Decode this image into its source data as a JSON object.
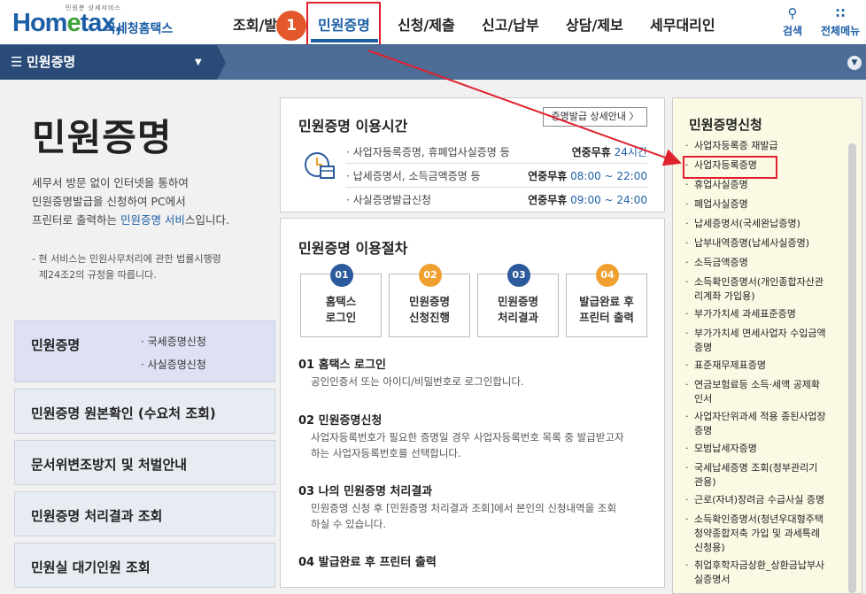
{
  "header": {
    "logo_tagline": "민원분 상세서비스",
    "logo_word_a": "Hom",
    "logo_word_e": "e",
    "logo_word_b": "tax,",
    "logo_kor": "국세청홈택스",
    "nav": [
      "조회/발",
      "민원증명",
      "신청/제출",
      "신고/납부",
      "상담/제보",
      "세무대리인"
    ],
    "search_label": "검색",
    "allmenu_label": "전체메뉴"
  },
  "step_badge": "1",
  "subnav": {
    "current": "민원증명"
  },
  "left": {
    "title": "민원증명",
    "intro_1": "세무서 방문 없이 인터넷을 통하여",
    "intro_2": "민원증명발급을 신청하여 PC에서",
    "intro_3a": "프린터로 출력하는 ",
    "intro_3b": "민원증명 서비",
    "intro_3c": "스입니다.",
    "note_1": "- 현 서비스는 민원사무처리에 관한 법률시행령",
    "note_2": "제24조2의 규정을 따릅니다.",
    "menu": [
      {
        "title": "민원증명",
        "subs": [
          "· 국세증명신청",
          "· 사실증명신청"
        ]
      },
      {
        "title": "민원증명 원본확인 (수요처 조회)"
      },
      {
        "title": "문서위변조방지 및 처벌안내"
      },
      {
        "title": "민원증명 처리결과 조회"
      },
      {
        "title": "민원실 대기인원 조회"
      }
    ]
  },
  "hours": {
    "title": "민원증명 이용시간",
    "detail_btn": "증명발급 상세안내 〉",
    "rows": [
      {
        "label": "· 사업자등록증명, 휴폐업사실증명 등",
        "days": "연중무휴",
        "time": "24시간"
      },
      {
        "label": "· 납세증명서, 소득금액증명 등",
        "days": "연중무휴",
        "time": "08:00 ~ 22:00"
      },
      {
        "label": "· 사실증명발급신청",
        "days": "연중무휴",
        "time": "09:00 ~ 24:00"
      }
    ]
  },
  "process": {
    "title": "민원증명 이용절차",
    "steps": [
      {
        "num": "01",
        "l1": "홈택스",
        "l2": "로그인",
        "color": "#2c5a9c"
      },
      {
        "num": "02",
        "l1": "민원증명",
        "l2": "신청진행",
        "color": "#f0a030"
      },
      {
        "num": "03",
        "l1": "민원증명",
        "l2": "처리결과",
        "color": "#2c5a9c"
      },
      {
        "num": "04",
        "l1": "발급완료 후",
        "l2": "프린터 출력",
        "color": "#f0a030"
      }
    ],
    "details": [
      {
        "h": "01 홈택스 로그인",
        "d1": "공인인증서 또는 아이디/비밀번호로 로그인합니다.",
        "d2": ""
      },
      {
        "h": "02 민원증명신청",
        "d1": "사업자등록번호가 필요한 증명일 경우 사업자등록번호 목록 중 발급받고자",
        "d2": "하는 사업자등록번호를 선택합니다."
      },
      {
        "h": "03 나의 민원증명 처리결과",
        "d1": "민원증명 신청 후 [민원증명 처리결과 조회]에서 본인의 신청내역을 조회",
        "d2": "하실 수 있습니다."
      },
      {
        "h": "04 발급완료 후 프린터 출력",
        "d1": "",
        "d2": ""
      }
    ]
  },
  "right": {
    "title": "민원증명신청",
    "items": [
      [
        "사업자등록증 재발급"
      ],
      [
        "사업자등록증명"
      ],
      [
        "휴업사실증명"
      ],
      [
        "폐업사실증명"
      ],
      [
        "납세증명서(국세완납증명)"
      ],
      [
        "납부내역증명(납세사실증명)"
      ],
      [
        "소득금액증명"
      ],
      [
        "소득확인증명서(개인종합자산관",
        "리계좌 가입용)"
      ],
      [
        "부가가치세 과세표준증명"
      ],
      [
        "부가가치세 면세사업자 수입금액",
        "증명"
      ],
      [
        "표준재무제표증명"
      ],
      [
        "연금보험료등 소득·세액 공제확",
        "인서"
      ],
      [
        "사업자단위과세 적용 종된사업장",
        "증명"
      ],
      [
        "모범납세자증명"
      ],
      [
        "국세납세증명 조회(정부관리기",
        "관용)"
      ],
      [
        "근로(자녀)장려금 수급사실 증명"
      ],
      [
        "소득확인증명서(청년우대형주택",
        "청약종합저축 가입 및 과세특례",
        "신청용)"
      ],
      [
        "취업후학자금상환_상환금납부사",
        "실증명서"
      ]
    ]
  }
}
